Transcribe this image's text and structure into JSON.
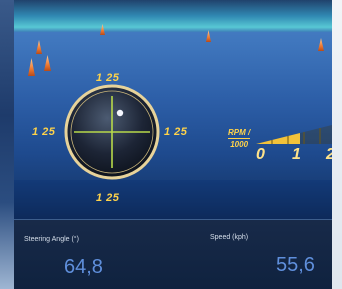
{
  "dial": {
    "top_label": "1 25",
    "left_label": "1 25",
    "right_label": "1 25",
    "bottom_label": "1 25"
  },
  "rpm": {
    "label_top": "RPM /",
    "label_bottom": "1000",
    "ticks": [
      "0",
      "1",
      "2"
    ],
    "level": 0.55
  },
  "panel": {
    "steering_label": "Steering Angle (°)",
    "steering_value": "64,8",
    "speed_label": "Speed (kph)",
    "speed_value": "55,6"
  },
  "colors": {
    "accent": "#ffd34a",
    "value": "#5f8fdc",
    "panel_bg": "#13284a"
  }
}
